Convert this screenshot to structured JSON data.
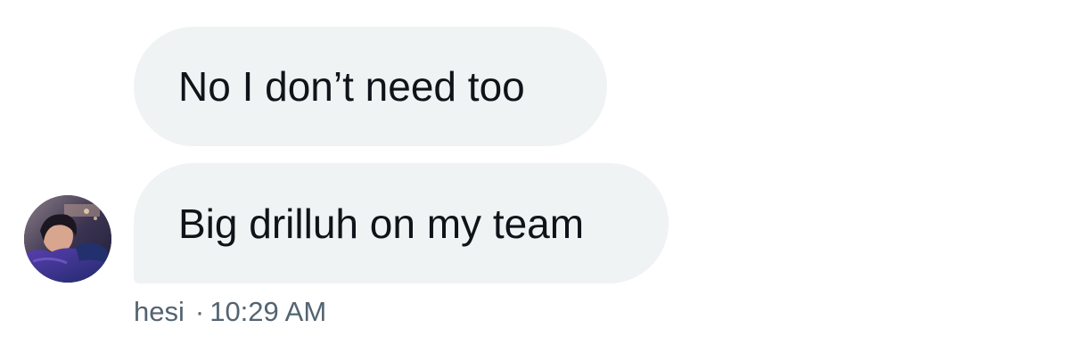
{
  "messages": [
    {
      "text": "No I don’t need too"
    },
    {
      "text": "Big drilluh on my team"
    }
  ],
  "sender": {
    "name": "hesi",
    "separator": "·",
    "time": "10:29 AM"
  },
  "colors": {
    "bubble_bg": "#eff3f4",
    "text": "#0f1419",
    "meta_text": "#536471",
    "background": "#ffffff"
  },
  "icons": {
    "avatar": "profile-photo-avatar"
  }
}
